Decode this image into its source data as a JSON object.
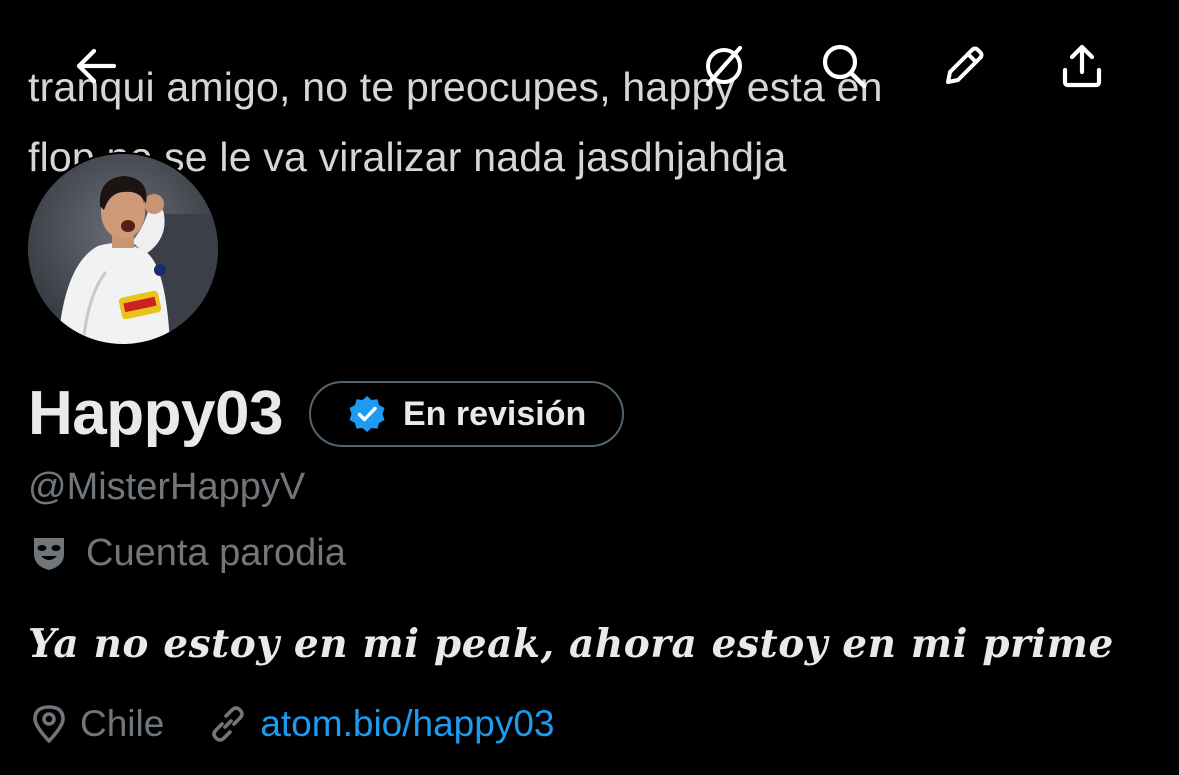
{
  "banner": {
    "text": "tranqui amigo, no te preocupes, happy esta en\nflop no se le va viralizar nada jasdhjahdja"
  },
  "topbar": {
    "back": "back-arrow-icon",
    "grok": "grok-icon",
    "search": "search-icon",
    "edit": "pencil-icon",
    "share": "share-icon"
  },
  "profile": {
    "display_name": "Happy03",
    "badge_label": "En revisión",
    "handle": "@MisterHappyV",
    "parody_label": "Cuenta parodia",
    "bio": "Ya no estoy en mi peak, ahora estoy en mi prime",
    "location": "Chile",
    "link": "atom.bio/happy03"
  },
  "colors": {
    "background": "#000000",
    "text_primary": "#e7e9ea",
    "text_secondary": "#71767b",
    "link": "#1d9bf0",
    "verified": "#1d9bf0",
    "badge_border": "#536471"
  }
}
